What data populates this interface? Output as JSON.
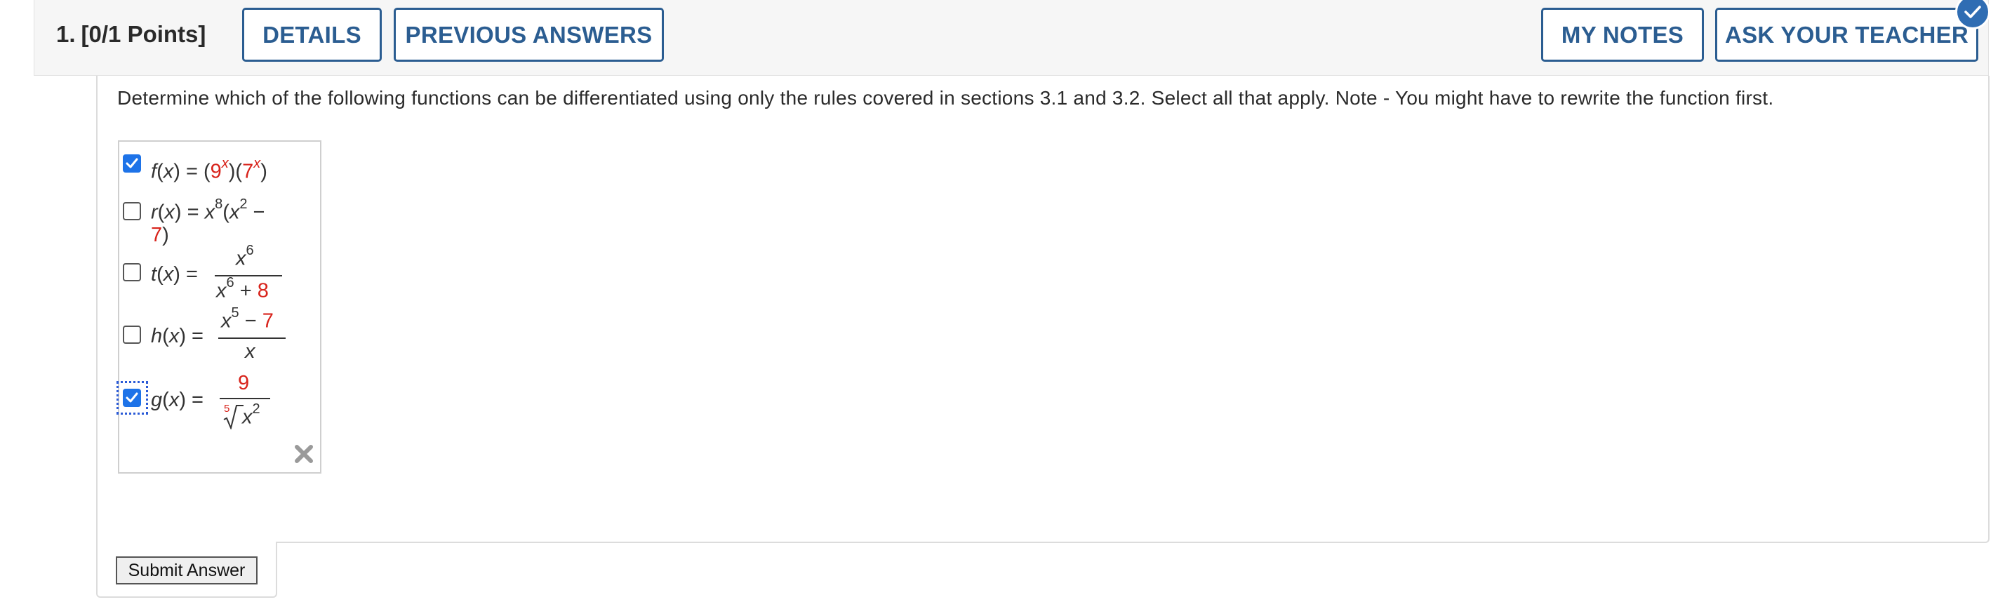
{
  "question": {
    "number": "1.",
    "points": "[0/1 Points]",
    "text": "Determine which of the following functions can be differentiated using only the rules covered in sections 3.1 and 3.2. Select all that apply. Note - You might have to rewrite the function first."
  },
  "toolbar": {
    "details_label": "DETAILS",
    "previous_answers_label": "PREVIOUS ANSWERS",
    "my_notes_label": "MY NOTES",
    "ask_teacher_label": "ASK YOUR TEACHER"
  },
  "options": [
    {
      "name": "f",
      "checked": true,
      "text": "f(x) = (9^x)(7^x)"
    },
    {
      "name": "r",
      "checked": false,
      "text": "r(x) = x^8(x^2 − 7)"
    },
    {
      "name": "t",
      "checked": false,
      "text": "t(x) = x^6 / (x^6 + 8)"
    },
    {
      "name": "h",
      "checked": false,
      "text": "h(x) = (x^5 − 7) / x"
    },
    {
      "name": "g",
      "checked": true,
      "text": "g(x) = 9 / fifth-root(x^2)"
    }
  ],
  "glyphs": {
    "equals": "=",
    "minus": "−",
    "plus": "+",
    "open_paren": "(",
    "close_paren": ")",
    "x": "x",
    "nine": "9",
    "seven": "7",
    "eight": "8",
    "six": "6",
    "five": "5",
    "two": "2"
  },
  "submit_label": "Submit Answer",
  "icons": [
    "checkmark-badge-icon",
    "checkbox-check-icon",
    "clear-x-icon"
  ],
  "colors": {
    "accent": "#2b5d91",
    "checkbox_checked": "#1e73e8",
    "red_constant": "#d8231b",
    "badge": "#2f6db3"
  }
}
